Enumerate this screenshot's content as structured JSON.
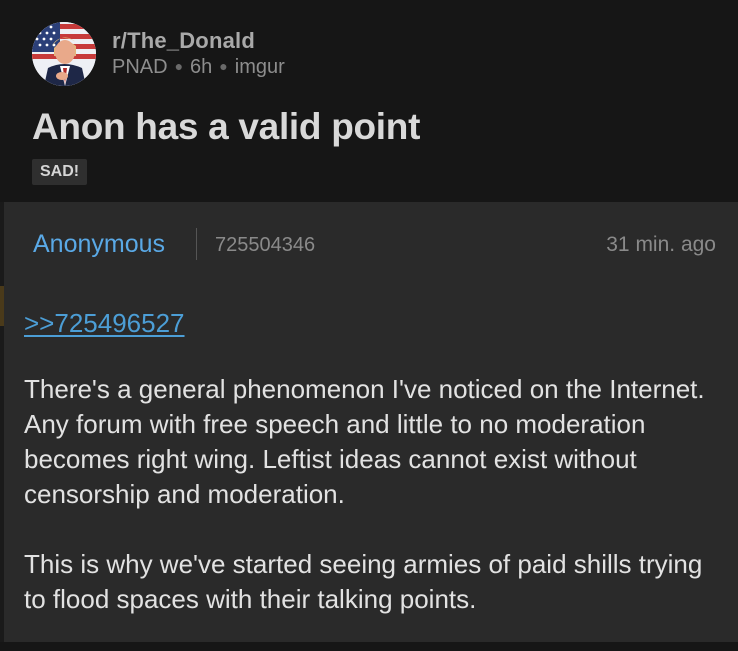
{
  "post": {
    "subreddit": "r/The_Donald",
    "author": "PNAD",
    "age": "6h",
    "source": "imgur",
    "title": "Anon has a valid point",
    "flair": "SAD!"
  },
  "greentext": {
    "poster_name": "Anonymous",
    "post_id": "725504346",
    "timestamp": "31 min. ago",
    "reply_link": ">>725496527",
    "paragraphs": [
      "There's a general phenomenon I've noticed on the Internet. Any forum with free speech and little to no moderation becomes right wing. Leftist ideas cannot exist without censorship and moderation.",
      "This is why we've started seeing armies of paid shills trying to flood spaces with their talking points."
    ]
  },
  "colors": {
    "background": "#161616",
    "card": "#2a2a2a",
    "link_blue": "#4c9ed6",
    "name_blue": "#5aa9e6"
  }
}
